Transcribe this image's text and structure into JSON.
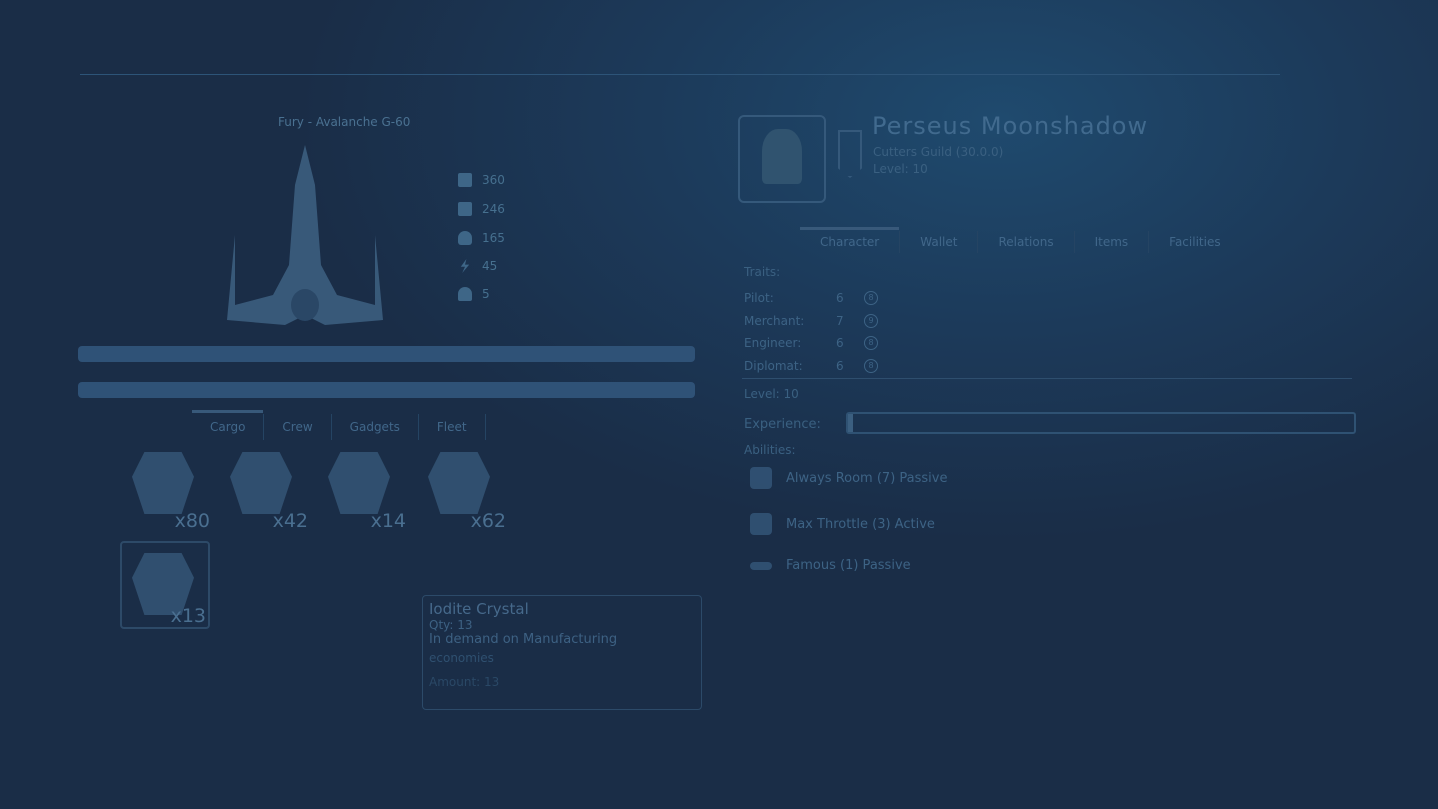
{
  "ship": {
    "title": "Fury - Avalanche G-60",
    "stats": [
      {
        "icon": "shield-icon",
        "value": "360"
      },
      {
        "icon": "cargo-icon",
        "value": "246"
      },
      {
        "icon": "fuel-icon",
        "value": "165"
      },
      {
        "icon": "energy-icon",
        "value": "45"
      },
      {
        "icon": "crew-icon",
        "value": "5"
      }
    ]
  },
  "tabs": [
    "Cargo",
    "Crew",
    "Gadgets",
    "Fleet"
  ],
  "cargo": [
    {
      "qty": "x80"
    },
    {
      "qty": "x42"
    },
    {
      "qty": "x14"
    },
    {
      "qty": "x62"
    },
    {
      "qty": "x13"
    }
  ],
  "tooltip": {
    "title": "Iodite Crystal",
    "qty": "Qty: 13",
    "desc1": "In demand on Manufacturing",
    "desc2": "economies",
    "footer": "Amount: 13"
  },
  "character": {
    "name": "Perseus Moonshadow",
    "guild": "Cutters Guild  (30.0.0)",
    "level": "Level: 10"
  },
  "char_tabs": [
    "Character",
    "Wallet",
    "Relations",
    "Items",
    "Facilities"
  ],
  "traits_label": "Traits:",
  "traits": [
    {
      "name": "Pilot:",
      "value": "6",
      "cost": "8"
    },
    {
      "name": "Merchant:",
      "value": "7",
      "cost": "9"
    },
    {
      "name": "Engineer:",
      "value": "6",
      "cost": "8"
    },
    {
      "name": "Diplomat:",
      "value": "6",
      "cost": "8"
    }
  ],
  "level": "Level: 10",
  "experience_label": "Experience:",
  "experience_progress": 0.01,
  "abilities_label": "Abilities:",
  "abilities": [
    {
      "label": "Always Room (7)  Passive",
      "icon": "shield-icon"
    },
    {
      "label": "Max Throttle (3)  Active",
      "icon": "throttle-icon"
    },
    {
      "label": "Famous (1)  Passive",
      "icon": "fame-icon"
    }
  ]
}
